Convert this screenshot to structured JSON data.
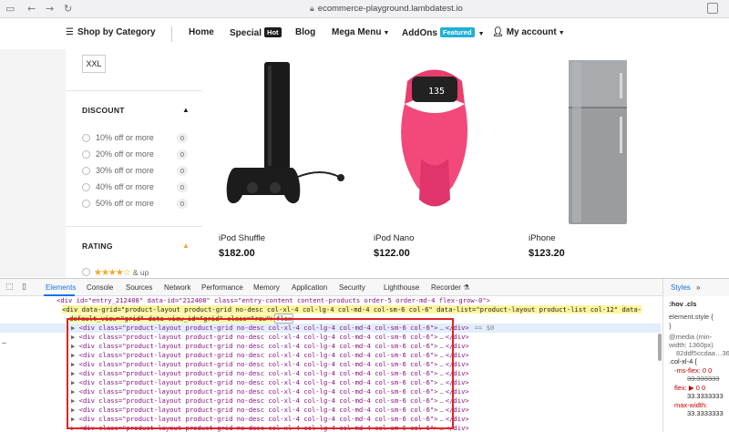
{
  "browser": {
    "url": "ecommerce-playground.lambdatest.io"
  },
  "nav": {
    "shop_by_category": "Shop by Category",
    "home": "Home",
    "special": "Special",
    "special_badge": "Hot",
    "blog": "Blog",
    "mega_menu": "Mega Menu",
    "addons": "AddOns",
    "addons_badge": "Featured",
    "my_account": "My account"
  },
  "sidebar": {
    "size_chip": "XXL",
    "discount_title": "DISCOUNT",
    "discount_options": [
      {
        "label": "10% off or more",
        "count": "0"
      },
      {
        "label": "20% off or more",
        "count": "0"
      },
      {
        "label": "30% off or more",
        "count": "0"
      },
      {
        "label": "40% off or more",
        "count": "0"
      },
      {
        "label": "50% off or more",
        "count": "0"
      }
    ],
    "rating_title": "RATING",
    "rating_up": "& up",
    "rating_stars": 4
  },
  "products": [
    {
      "name": "iPod Shuffle",
      "price": "$182.00"
    },
    {
      "name": "iPod Nano",
      "price": "$122.00"
    },
    {
      "name": "iPhone",
      "price": "$123.20"
    }
  ],
  "devtools": {
    "tabs": [
      "Elements",
      "Console",
      "Sources",
      "Network",
      "Performance",
      "Memory",
      "Application",
      "Security",
      "Lighthouse",
      "Recorder"
    ],
    "warnings": "4",
    "styles_tabs": [
      "Styles",
      "»"
    ],
    "dom_top": "<div id=\"entry_212408\" data-id=\"212408\" class=\"entry-content content-products order-5 order-md-4 flex-grow-0\">",
    "dom_grid_1": "<div data-grid=\"product-layout product-grid no-desc col-xl-4 col-lg-4 col-md-4 col-sm-6 col-6\" data-list=\"product-layout product-list col-12\" data-",
    "dom_grid_2": "default_view=\"grid\" data-view_id=\"grid\" class=\"row\">",
    "dom_grid_flex": "flex",
    "dom_row": "<div class=\"product-layout product-grid no-desc col-xl-4 col-lg-4 col-md-4 col-sm-6 col-6\">",
    "dom_row_end": "</div>",
    "dom_row_ellipsis": "…",
    "dom_selected_marker": "== $0",
    "dom_row_count": 12,
    "styles": {
      "hov": ":hov .cls",
      "element_style": "element.style {",
      "close": "}",
      "media": "@media (min-",
      "media2": "width: 1360px)",
      "file": "82ddf5ccdaa…36",
      "selector": ".col-xl-4 {",
      "p1": "-ms-flex: 0 0",
      "p1b": "33.333333",
      "p2": "flex: ▶ 0 0",
      "p2b": "33.3333333",
      "p3": "max-width:",
      "p3b": "33.3333333"
    }
  }
}
